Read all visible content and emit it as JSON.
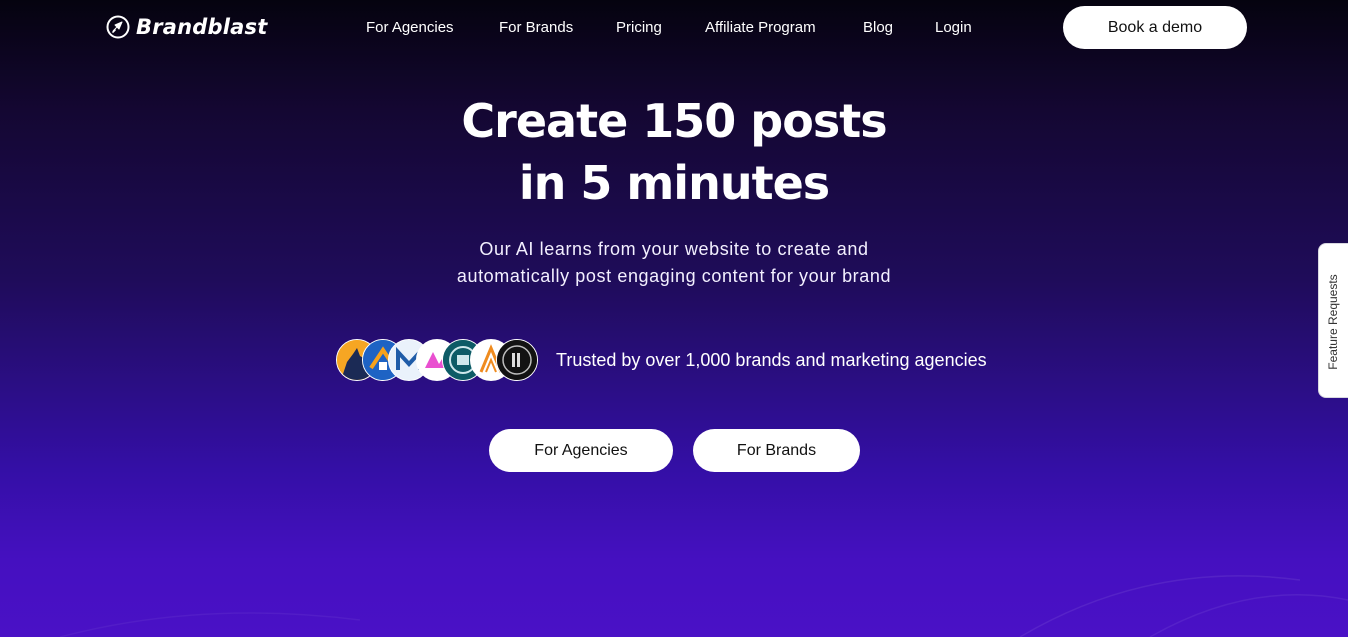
{
  "brand": {
    "name": "Brandblast",
    "logo_icon": "rocket-circle-icon"
  },
  "nav": {
    "items": [
      {
        "label": "For Agencies"
      },
      {
        "label": "For Brands"
      },
      {
        "label": "Pricing"
      },
      {
        "label": "Affiliate Program"
      },
      {
        "label": "Blog"
      },
      {
        "label": "Login"
      }
    ],
    "cta_label": "Book a demo"
  },
  "hero": {
    "title_line1": "Create 150 posts",
    "title_line2": "in 5 minutes",
    "subtitle_line1": "Our AI learns from your website to create and",
    "subtitle_line2": "automatically post engaging content for your brand"
  },
  "social_proof": {
    "text": "Trusted by over 1,000 brands and marketing agencies"
  },
  "buttons": {
    "agencies_label": "For Agencies",
    "brands_label": "For Brands"
  },
  "feature_tab": {
    "label": "Feature Requests"
  },
  "colors": {
    "background_top": "#05030f",
    "background_bottom": "#4a11c6",
    "button_bg": "#ffffff",
    "button_text": "#111111"
  }
}
